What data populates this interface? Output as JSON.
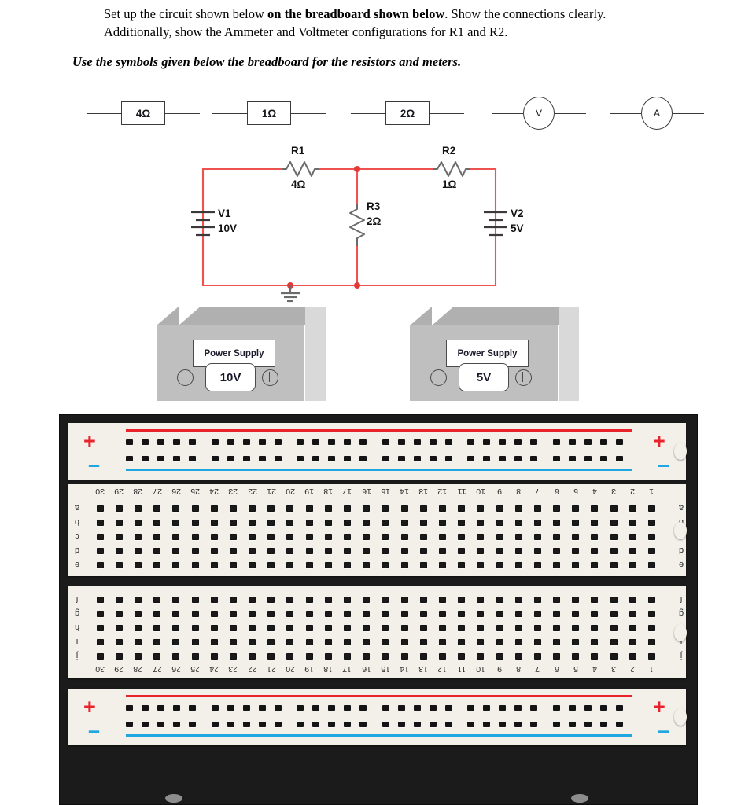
{
  "prompt": {
    "line1_a": "Set up the circuit shown below ",
    "line1_b": "on the breadboard shown below",
    "line1_c": ". Show the connections clearly.",
    "line2": "Additionally, show the Ammeter and Voltmeter configurations for R1 and R2.",
    "instruction": "Use the symbols given below the breadboard for the resistors and meters."
  },
  "symbols": {
    "items": [
      {
        "name": "resistor-4-ohm",
        "label": "4Ω",
        "type": "resistor"
      },
      {
        "name": "resistor-1-ohm",
        "label": "1Ω",
        "type": "resistor"
      },
      {
        "name": "resistor-2-ohm",
        "label": "2Ω",
        "type": "resistor"
      },
      {
        "name": "voltmeter",
        "label": "V",
        "type": "meter"
      },
      {
        "name": "ammeter",
        "label": "A",
        "type": "meter"
      }
    ]
  },
  "circuit": {
    "wire_color": "#ef5350",
    "node_color": "#e53935",
    "components": [
      {
        "id": "R1",
        "value": "4Ω",
        "kind": "resistor",
        "orientation": "horizontal"
      },
      {
        "id": "R2",
        "value": "1Ω",
        "kind": "resistor",
        "orientation": "horizontal"
      },
      {
        "id": "R3",
        "value": "2Ω",
        "kind": "resistor",
        "orientation": "vertical"
      },
      {
        "id": "V1",
        "value": "10V",
        "kind": "battery",
        "orientation": "vertical"
      },
      {
        "id": "V2",
        "value": "5V",
        "kind": "battery",
        "orientation": "vertical"
      }
    ],
    "ground": {
      "name": "ground-symbol",
      "present": true
    },
    "labels": {
      "r1_name": "R1",
      "r1_value": "4Ω",
      "r2_name": "R2",
      "r2_value": "1Ω",
      "r3_name": "R3",
      "r3_value": "2Ω",
      "v1_name": "V1",
      "v1_value": "10V",
      "v2_name": "V2",
      "v2_value": "5V"
    }
  },
  "power_supplies": [
    {
      "name": "power-supply-10v",
      "screen_label": "Power Supply",
      "value": "10V",
      "neg_terminal": "⊖",
      "pos_terminal": "⊕"
    },
    {
      "name": "power-supply-5v",
      "screen_label": "Power Supply",
      "value": "5V",
      "neg_terminal": "⊖",
      "pos_terminal": "⊕"
    }
  ],
  "breadboard": {
    "orientation": "rotated-180",
    "frame_color": "#1b1b1b",
    "body_color": "#f3f0ea",
    "rail_positive_marker": "+",
    "rail_negative_marker": "–",
    "rail_positive_color": "#e8232c",
    "rail_negative_color": "#1ea7e0",
    "rail_hole_groups": 6,
    "rail_holes_per_group": 5,
    "columns": [
      30,
      29,
      28,
      27,
      26,
      25,
      24,
      23,
      22,
      21,
      20,
      19,
      18,
      17,
      16,
      15,
      14,
      13,
      12,
      11,
      10,
      9,
      8,
      7,
      6,
      5,
      4,
      3,
      2,
      1
    ],
    "top_rows": [
      "a",
      "b",
      "c",
      "d",
      "e"
    ],
    "bottom_rows": [
      "f",
      "g",
      "h",
      "i",
      "j"
    ],
    "sections": [
      {
        "name": "top-power-rail",
        "type": "rail"
      },
      {
        "name": "upper-terminal-strip",
        "type": "grid",
        "rows": [
          "a",
          "b",
          "c",
          "d",
          "e"
        ],
        "numbers_position": "top"
      },
      {
        "name": "lower-terminal-strip",
        "type": "grid",
        "rows": [
          "f",
          "g",
          "h",
          "i",
          "j"
        ],
        "numbers_position": "bottom"
      },
      {
        "name": "bottom-power-rail",
        "type": "rail"
      }
    ]
  }
}
